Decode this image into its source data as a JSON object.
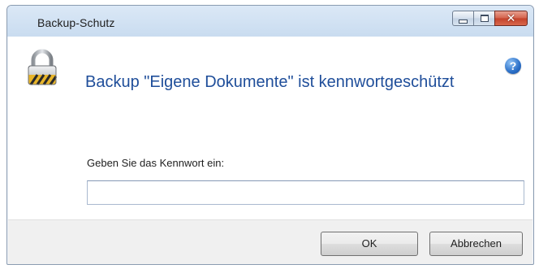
{
  "window": {
    "title": "Backup-Schutz",
    "close_glyph": "✕"
  },
  "icons": {
    "main": "padlock-icon",
    "help": "help-icon",
    "help_glyph": "?"
  },
  "content": {
    "headline": "Backup \"Eigene Dokumente\" ist kennwortgeschützt",
    "prompt_label": "Geben Sie das Kennwort ein:",
    "password_value": ""
  },
  "buttons": {
    "ok_label": "OK",
    "cancel_label": "Abbrechen"
  },
  "colors": {
    "headline": "#1f4e9a",
    "titlebar": "#c9dcf0",
    "close_button": "#c3412a"
  }
}
